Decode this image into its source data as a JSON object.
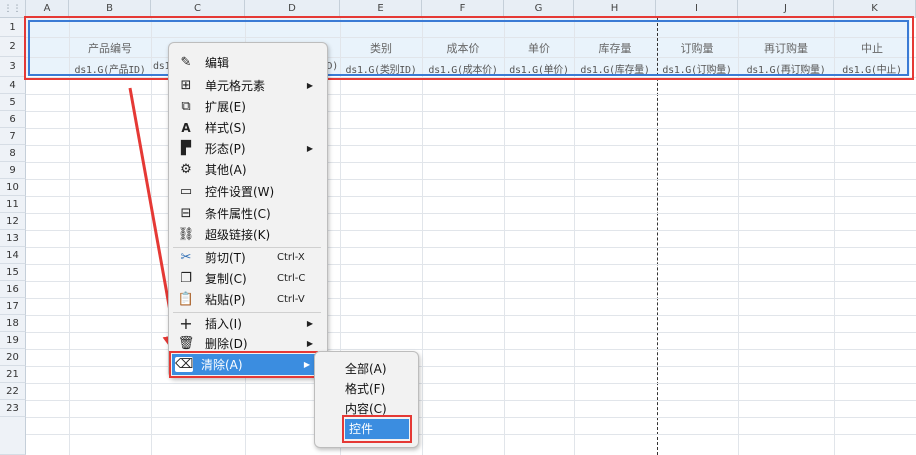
{
  "columns": [
    "A",
    "B",
    "C",
    "D",
    "E",
    "F",
    "G",
    "H",
    "I",
    "J",
    "K"
  ],
  "rows": [
    "1",
    "2",
    "3",
    "4",
    "5",
    "6",
    "7",
    "8",
    "9",
    "10",
    "11",
    "12",
    "13",
    "14",
    "15",
    "16",
    "17",
    "18",
    "19",
    "20",
    "21",
    "22",
    "23"
  ],
  "header_row": {
    "b": "产品编号",
    "e": "类别",
    "f": "成本价",
    "g": "单价",
    "h": "库存量",
    "i": "订购量",
    "j": "再订购量",
    "k": "中止"
  },
  "field_row": {
    "b": "ds1.G(产品ID)",
    "c": "ds1.G(",
    "d": "D)",
    "e": "ds1.G(类别ID)",
    "f": "ds1.G(成本价)",
    "g": "ds1.G(单价)",
    "h": "ds1.G(库存量)",
    "i": "ds1.G(订购量)",
    "j": "ds1.G(再订购量)",
    "k": "ds1.G(中止)"
  },
  "context_menu": {
    "edit": "编辑",
    "cell_element": "单元格元素",
    "expand": "扩展(E)",
    "style": "样式(S)",
    "shape": "形态(P)",
    "other": "其他(A)",
    "widget_settings": "控件设置(W)",
    "condition_attr": "条件属性(C)",
    "hyperlink": "超级链接(K)",
    "cut": "剪切(T)",
    "cut_shortcut": "Ctrl-X",
    "copy": "复制(C)",
    "copy_shortcut": "Ctrl-C",
    "paste": "粘贴(P)",
    "paste_shortcut": "Ctrl-V",
    "insert": "插入(I)",
    "delete": "删除(D)",
    "clear": "清除(A)"
  },
  "submenu": {
    "all": "全部(A)",
    "format": "格式(F)",
    "content": "内容(C)",
    "widget": "控件"
  },
  "colors": {
    "accent": "#3b8de0",
    "annotation": "#e53935",
    "selection": "#3a7bd5"
  }
}
